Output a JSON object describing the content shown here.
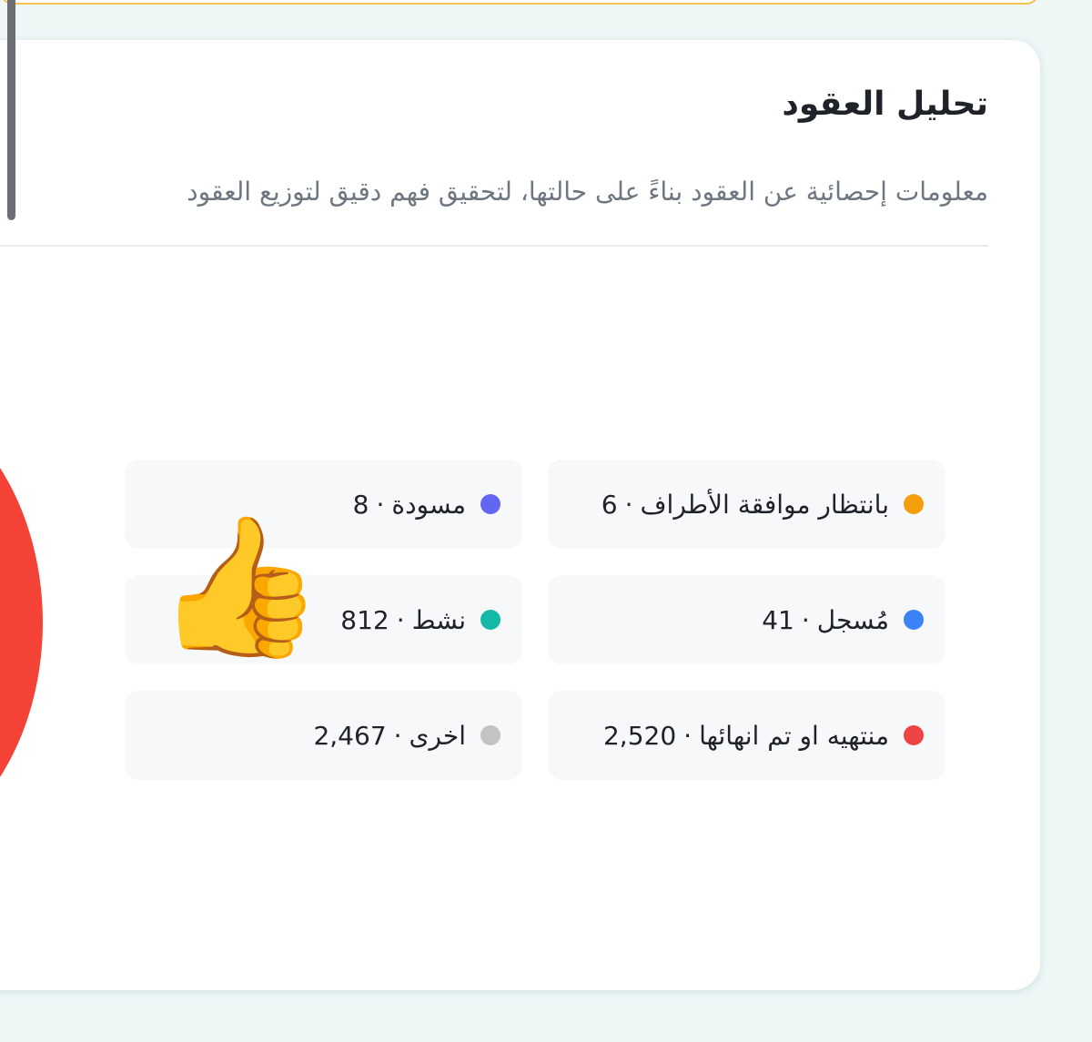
{
  "card": {
    "title": "تحليل العقود",
    "subtitle": "معلومات إحصائية عن العقود بناءً على حالتها، لتحقيق فهم دقيق لتوزيع العقود"
  },
  "legend": [
    {
      "label": "بانتظار موافقة الأطراف",
      "value": "6",
      "color": "#f59e0b"
    },
    {
      "label": "مسودة",
      "value": "8",
      "color": "#6366f1"
    },
    {
      "label": "مُسجل",
      "value": "41",
      "color": "#3b82f6"
    },
    {
      "label": "نشط",
      "value": "812",
      "color": "#14b8a6"
    },
    {
      "label": "منتهيه او تم انهائها",
      "value": "2,520",
      "color": "#ef4444"
    },
    {
      "label": "اخرى",
      "value": "2,467",
      "color": "#c4c2c2"
    }
  ],
  "separator": "·",
  "overlay_emoji": "👍",
  "pie_color": "#f44336"
}
